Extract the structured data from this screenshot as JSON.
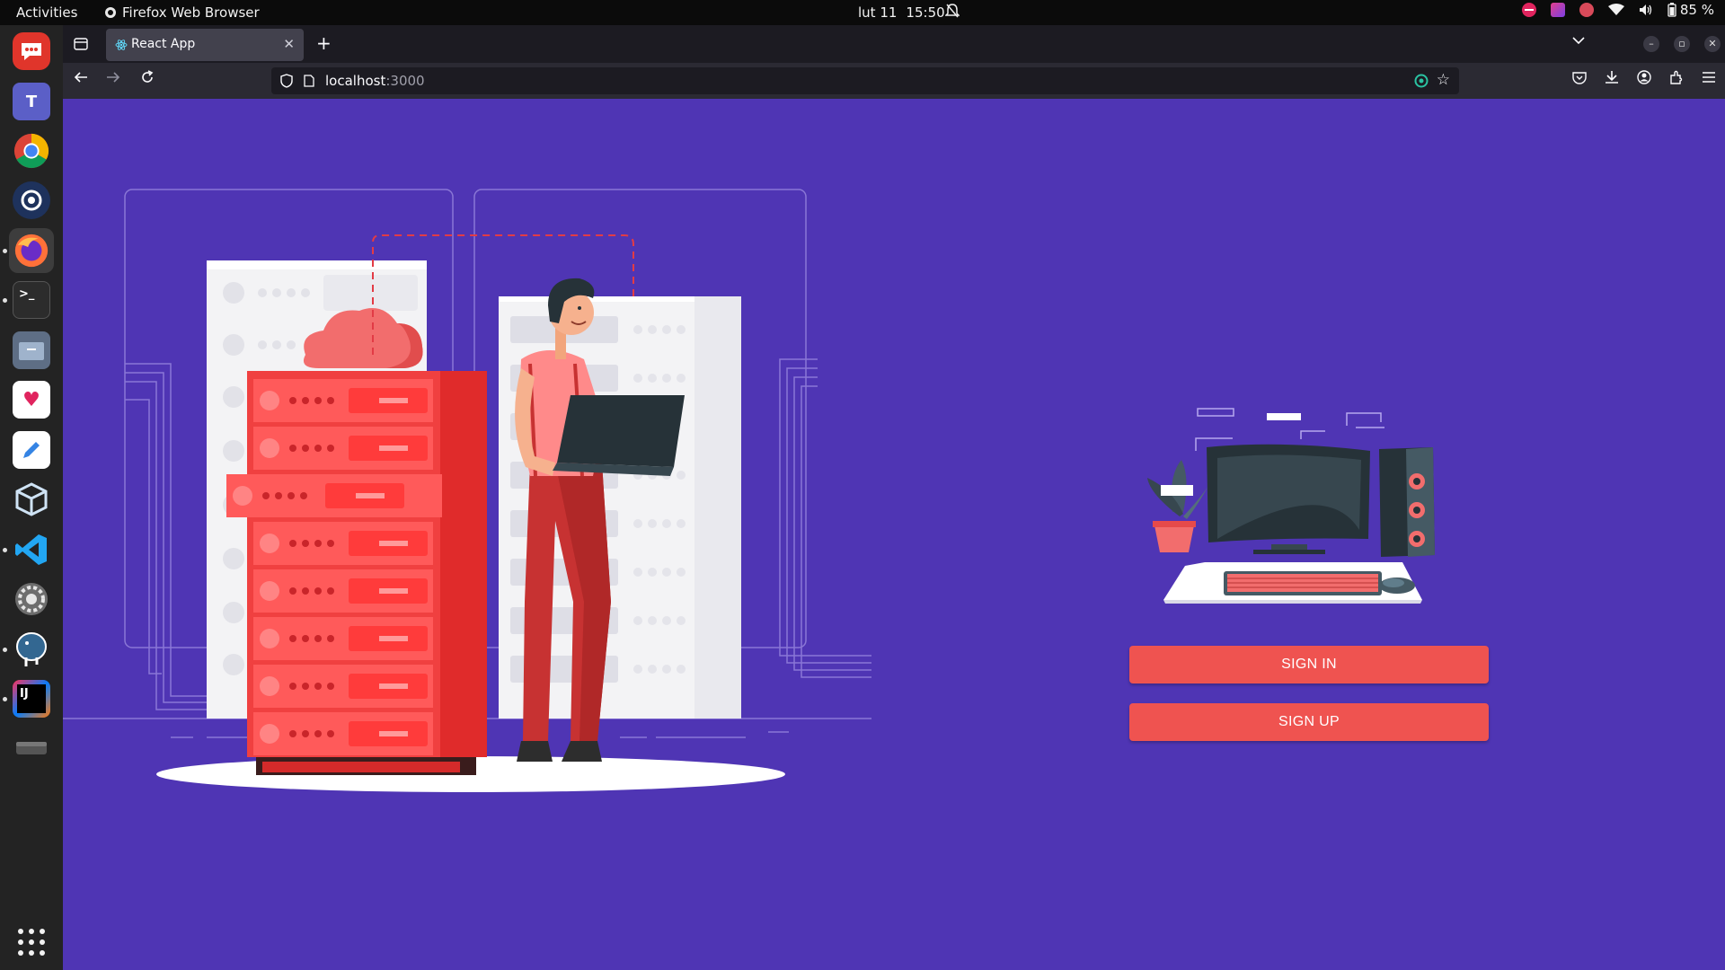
{
  "topbar": {
    "activities": "Activities",
    "app_name": "Firefox Web Browser",
    "date": "lut 11",
    "time": "15:50",
    "battery": "85 %"
  },
  "dock": {
    "apps": [
      {
        "name": "Rocket.Chat",
        "color": "#e0352b",
        "icon": "chat-icon"
      },
      {
        "name": "Microsoft Teams",
        "color": "#5b5fc7",
        "icon": "teams-icon"
      },
      {
        "name": "Google Chrome",
        "color": "#ffffff",
        "icon": "chrome-icon"
      },
      {
        "name": "Mattermost",
        "color": "#1e325c",
        "icon": "mattermost-icon"
      },
      {
        "name": "Firefox",
        "color": "#ff7139",
        "icon": "firefox-icon"
      },
      {
        "name": "Terminal",
        "color": "#2c2c2c",
        "icon": "terminal-icon"
      },
      {
        "name": "Files",
        "color": "#5e6e85",
        "icon": "files-icon"
      },
      {
        "name": "Solitaire",
        "color": "#ffffff",
        "icon": "cards-icon"
      },
      {
        "name": "Text Editor",
        "color": "#ffffff",
        "icon": "text-editor-icon"
      },
      {
        "name": "VirtualBox",
        "color": "#1b5e91",
        "icon": "virtualbox-icon"
      },
      {
        "name": "VS Code",
        "color": "#0078d4",
        "icon": "vscode-icon"
      },
      {
        "name": "Settings",
        "color": "#5d5d5d",
        "icon": "settings-icon"
      },
      {
        "name": "pgAdmin",
        "color": "#336791",
        "icon": "postgres-icon"
      },
      {
        "name": "IntelliJ IDEA",
        "color": "#000000",
        "icon": "intellij-icon"
      },
      {
        "name": "Drive",
        "color": "#4a4a4a",
        "icon": "drive-icon"
      }
    ],
    "show_apps_icon": "grid-icon"
  },
  "browser": {
    "tab_title": "React App",
    "url_host": "localhost",
    "url_port": ":3000"
  },
  "page": {
    "signin_label": "SIGN IN",
    "signup_label": "SIGN UP",
    "accent_color": "#ef5350",
    "background_color": "#4f35b4"
  }
}
